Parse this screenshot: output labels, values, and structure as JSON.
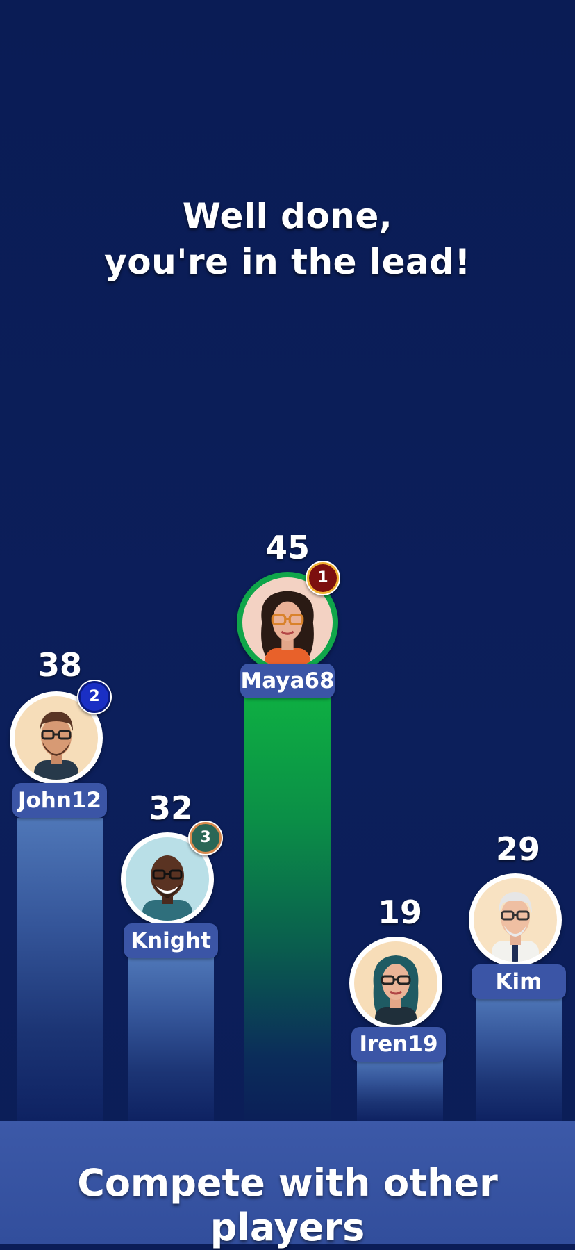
{
  "headline": {
    "line1": "Well done,",
    "line2": "you're in the lead!"
  },
  "players": [
    {
      "name": "John12",
      "score": "38",
      "rank": "2",
      "rank_color": "#1a2fc4",
      "avatar_icon": "man-glasses-beard-avatar-icon"
    },
    {
      "name": "Knight",
      "score": "32",
      "rank": "3",
      "rank_color": "#2a6756",
      "avatar_icon": "man-glasses-smiling-avatar-icon"
    },
    {
      "name": "Maya68",
      "score": "45",
      "rank": "1",
      "rank_color": "#7c0f0f",
      "avatar_icon": "woman-curly-hair-glasses-avatar-icon",
      "is_current_user": true,
      "highlight_color": "#0fa64a"
    },
    {
      "name": "Iren19",
      "score": "19",
      "avatar_icon": "woman-glasses-avatar-icon"
    },
    {
      "name": "Kim",
      "score": "29",
      "avatar_icon": "elderly-man-doctor-avatar-icon"
    }
  ],
  "footer": {
    "text": "Compete with other players"
  },
  "colors": {
    "background": "#0b1d57",
    "bar_blue": "#3b55a6",
    "bar_lead": "#0fa64a",
    "name_tag": "#3b55a6"
  }
}
